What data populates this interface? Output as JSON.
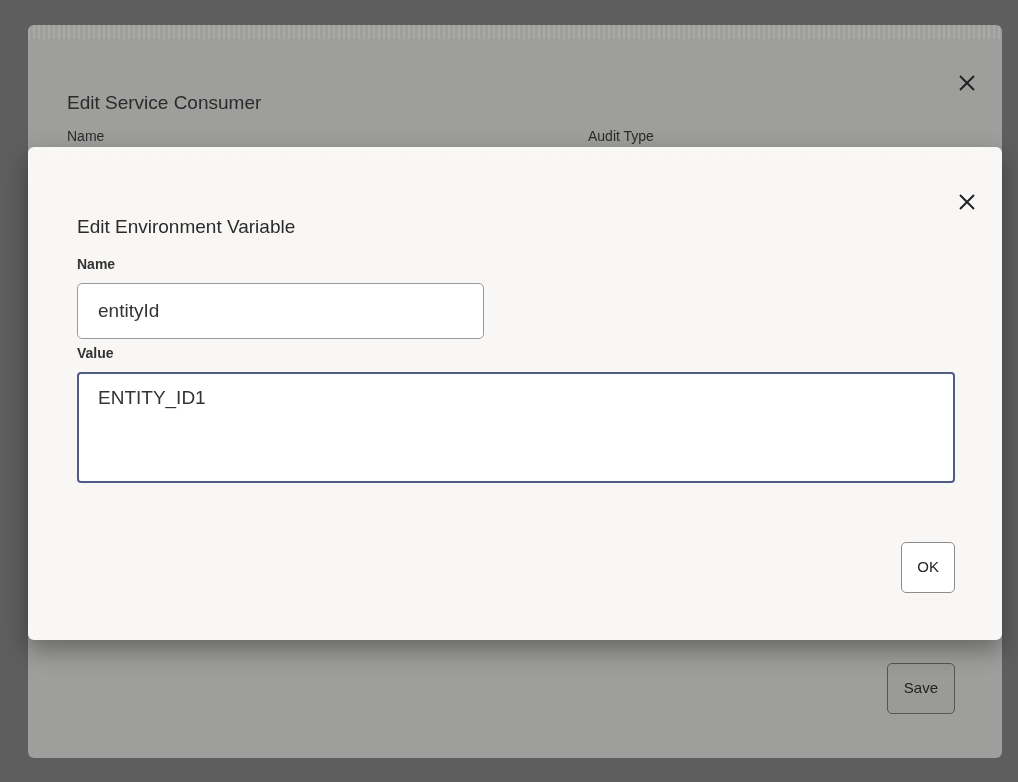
{
  "background_dialog": {
    "title": "Edit Service Consumer",
    "field_labels": [
      "Name",
      "Audit Type"
    ],
    "buttons": [
      "Save"
    ]
  },
  "dialog": {
    "title": "Edit Environment Variable",
    "fields": [
      {
        "label": "Name",
        "kind": "input",
        "value": "entityId",
        "focused": false
      },
      {
        "label": "Value",
        "kind": "textarea",
        "value": "ENTITY_ID1",
        "focused": true
      }
    ],
    "buttons": [
      "OK"
    ]
  }
}
